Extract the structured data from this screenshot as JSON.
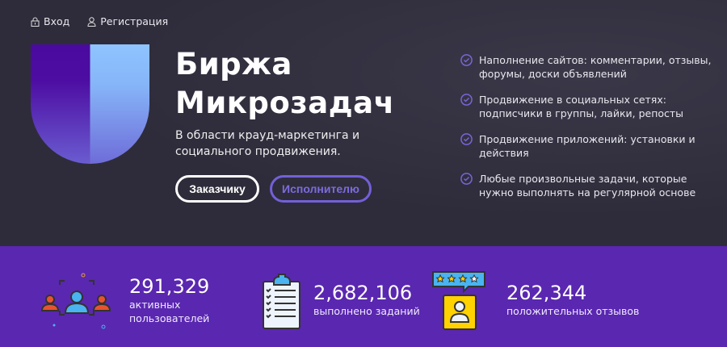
{
  "nav": {
    "login": "Вход",
    "register": "Регистрация"
  },
  "hero": {
    "title_line1": "Биржа",
    "title_line2": "Микрозадач",
    "subtitle": "В области крауд-маркетинга и социального продвижения.",
    "customer_button": "Заказчику",
    "performer_button": "Исполнителю"
  },
  "features": [
    "Наполнение сайтов: комментарии, отзывы, форумы, доски объявлений",
    "Продвижение в социальных сетях: подписчики в группы, лайки, репосты",
    "Продвижение приложений: установки и действия",
    "Любые произвольные задачи, которые нужно выполнять на регулярной основе"
  ],
  "stats": [
    {
      "value": "291,329",
      "label_line1": "активных",
      "label_line2": "пользователей"
    },
    {
      "value": "2,682,106",
      "label_line1": "выполнено заданий"
    },
    {
      "value": "262,344",
      "label_line1": "положительных отзывов"
    }
  ],
  "colors": {
    "background": "#2e2c3a",
    "band": "#5a27b0",
    "accent": "#7260d8"
  }
}
